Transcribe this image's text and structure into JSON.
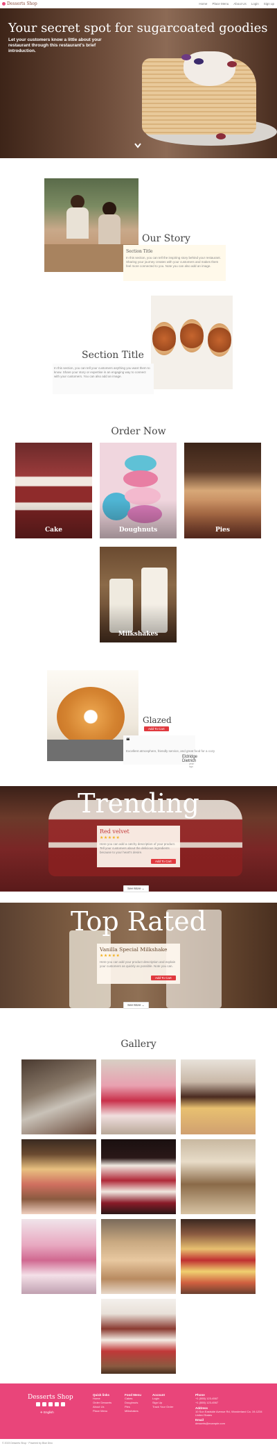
{
  "nav": {
    "brand": "Desserts Shop",
    "links": [
      "Home",
      "Place Menu",
      "About Us",
      "Login",
      "Sign up"
    ]
  },
  "hero": {
    "title": "Your secret spot for sugarcoated goodies",
    "subtitle": "Let your customers know a little about your restaurant through this restaurant's brief introduction.",
    "scroll_icon": "chevron-down-icon"
  },
  "story": {
    "title": "Our Story",
    "card_title": "Section Title",
    "card_text": "In this section, you can tell the inspiring story behind your restaurant. Sharing your journey creates with your customers and makes them feel more connected to you. Note you can also add an image."
  },
  "section2": {
    "title": "Section Title",
    "text": "In this section, you can tell your customers anything you want them to know. Share your story or expertise in an engaging way to connect with your customers. You can also add an image."
  },
  "order": {
    "title": "Order Now",
    "items": [
      "Cake",
      "Doughnuts",
      "Pies",
      "Milkshakes"
    ]
  },
  "glazed": {
    "title": "Glazed",
    "button": "Add To Cart",
    "quote_icon": "quote-icon",
    "review_text": "Excellent atmosphere, friendly service, and great food for a cozy",
    "reviewer": "Eldridge Dietrich",
    "review_date": "1 year ago"
  },
  "trending": {
    "title": "Trending",
    "product": "Red velvet",
    "stars": "★★★★★",
    "text": "Here you can add a catchy description of your product. Tell your customers about the delicious ingredients because to your heart's desire.",
    "button": "Add To Cart",
    "see_more": "See More"
  },
  "top_rated": {
    "title": "Top Rated",
    "product": "Vanilla Special Milkshake",
    "stars": "★★★★★",
    "text": "Here you can add your product description and explain your customers as quickly as possible. Note you can.",
    "button": "Add To Cart",
    "see_more": "See More"
  },
  "gallery": {
    "title": "Gallery"
  },
  "footer": {
    "brand": "Desserts Shop",
    "lang": "English",
    "cols": [
      {
        "title": "Quick links",
        "links": [
          "Home",
          "Order Desserts",
          "About Us",
          "Place Menu"
        ]
      },
      {
        "title": "Food Menu",
        "links": [
          "Cakes",
          "Doughnuts",
          "Pies",
          "Milkshakes"
        ]
      },
      {
        "title": "Account",
        "links": [
          "Login",
          "Sign Up",
          "Track Your Order"
        ]
      }
    ],
    "phone_title": "Phone",
    "phones": [
      "+1 (555) 123-4567",
      "+1 (555) 123-4567"
    ],
    "address_title": "Address",
    "address": "10 Sun Eastside Avenue Rd, Wonderland Ca. 19-1234 United States",
    "email_title": "Email",
    "email": "desserts@example.com",
    "copyright": "© 2023 Desserts Shop · Powered by Blue Dino"
  },
  "colors": {
    "accent": "#e9457a",
    "button_red": "#e0393e",
    "star": "#f2b01e"
  }
}
